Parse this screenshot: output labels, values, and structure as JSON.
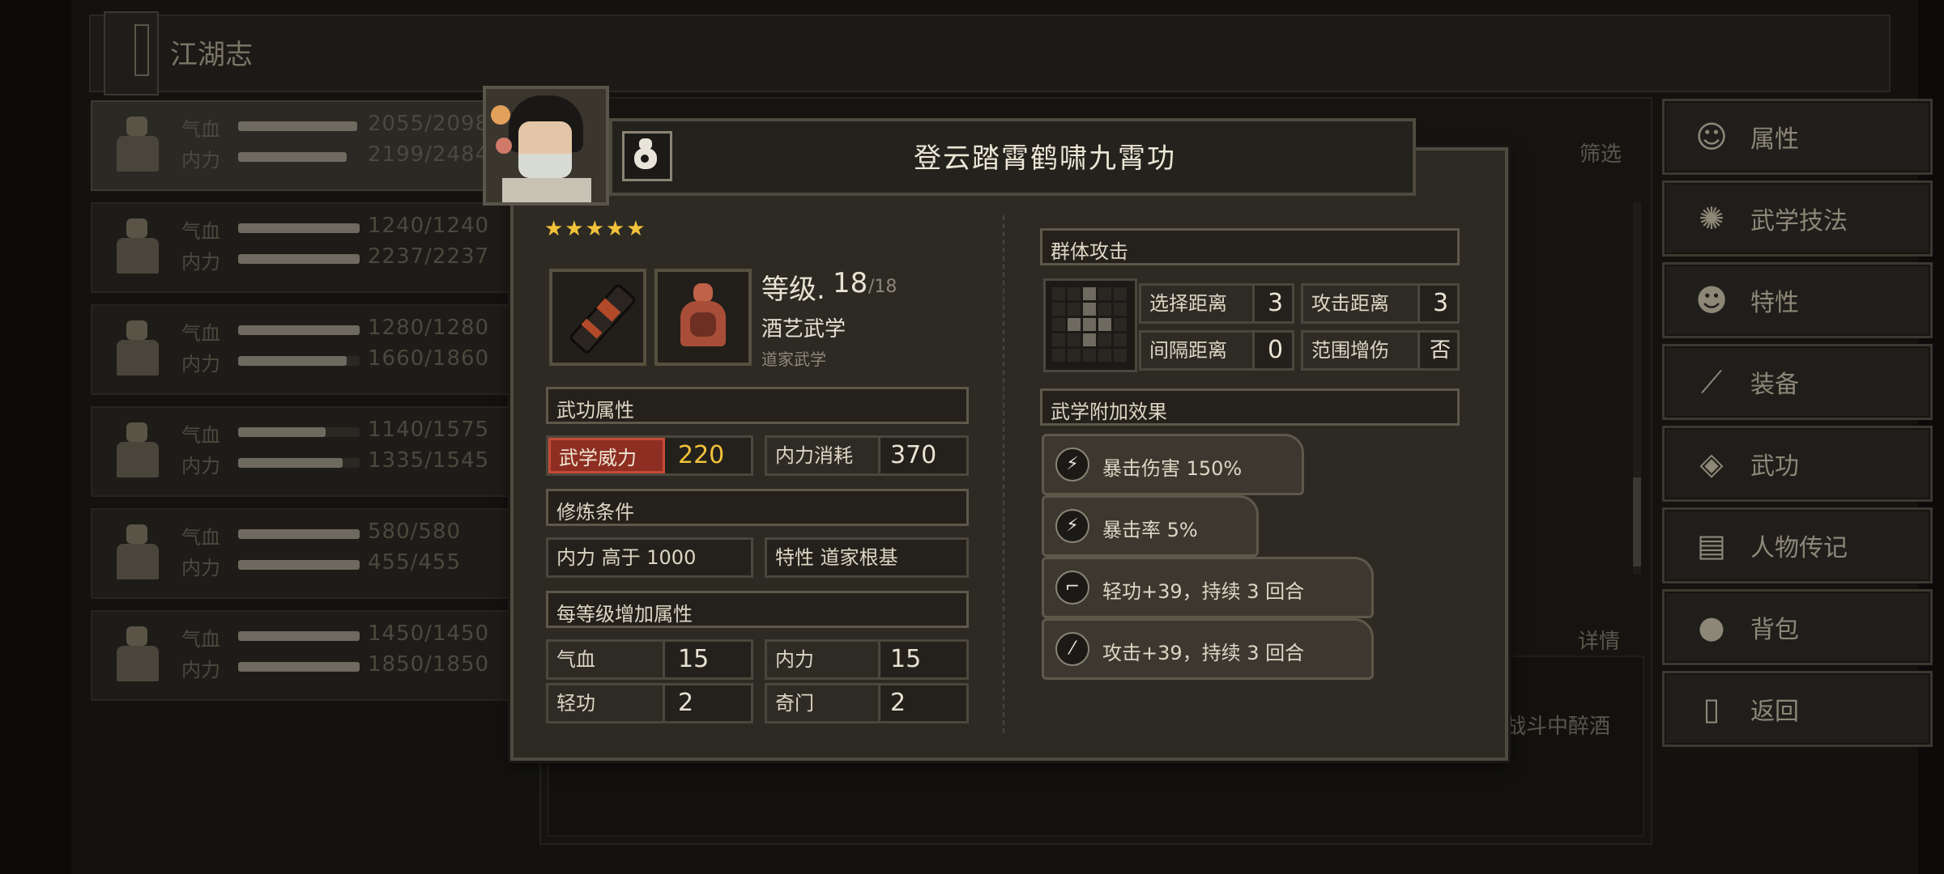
{
  "page": {
    "title": "江湖志",
    "filter_label": "筛选",
    "detail_label": "详情",
    "bg_text": "战斗中醉酒"
  },
  "characters": [
    {
      "hp_label": "气血",
      "mp_label": "内力",
      "hp": "2055/2098",
      "mp": "2199/2484",
      "hp_fill": 0.98,
      "mp_fill": 0.89
    },
    {
      "hp_label": "气血",
      "mp_label": "内力",
      "hp": "1240/1240",
      "mp": "2237/2237",
      "hp_fill": 1.0,
      "mp_fill": 1.0
    },
    {
      "hp_label": "气血",
      "mp_label": "内力",
      "hp": "1280/1280",
      "mp": "1660/1860",
      "hp_fill": 1.0,
      "mp_fill": 0.89
    },
    {
      "hp_label": "气血",
      "mp_label": "内力",
      "hp": "1140/1575",
      "mp": "1335/1545",
      "hp_fill": 0.72,
      "mp_fill": 0.86
    },
    {
      "hp_label": "气血",
      "mp_label": "内力",
      "hp": "580/580",
      "mp": "455/455",
      "hp_fill": 1.0,
      "mp_fill": 1.0
    },
    {
      "hp_label": "气血",
      "mp_label": "内力",
      "hp": "1450/1450",
      "mp": "1850/1850",
      "hp_fill": 1.0,
      "mp_fill": 1.0
    }
  ],
  "menu": [
    {
      "label": "属性",
      "icon": "person-icon"
    },
    {
      "label": "武学技法",
      "icon": "martial-skill-icon"
    },
    {
      "label": "特性",
      "icon": "trait-icon"
    },
    {
      "label": "装备",
      "icon": "sword-icon"
    },
    {
      "label": "武功",
      "icon": "book-icon"
    },
    {
      "label": "人物传记",
      "icon": "scroll-icon"
    },
    {
      "label": "背包",
      "icon": "bag-icon"
    },
    {
      "label": "返回",
      "icon": "door-icon"
    }
  ],
  "skill": {
    "name": "登云踏霄鹤啸九霄功",
    "stars": "★★★★★",
    "star_count": 5,
    "level_label": "等级.",
    "level": "18",
    "level_max": "/18",
    "type": "酒艺武学",
    "school": "道家武学",
    "attr_section": "武功属性",
    "power_label": "武学威力",
    "power_value": "220",
    "cost_label": "内力消耗",
    "cost_value": "370",
    "req_section": "修炼条件",
    "req1": "内力 高于 1000",
    "req2": "特性 道家根基",
    "per_level_section": "每等级增加属性",
    "per_level": [
      {
        "label": "气血",
        "value": "15"
      },
      {
        "label": "内力",
        "value": "15"
      },
      {
        "label": "轻功",
        "value": "2"
      },
      {
        "label": "奇门",
        "value": "2"
      }
    ],
    "attack_type": "群体攻击",
    "range": [
      {
        "label": "选择距离",
        "value": "3"
      },
      {
        "label": "攻击距离",
        "value": "3"
      },
      {
        "label": "间隔距离",
        "value": "0"
      },
      {
        "label": "范围增伤",
        "value": "否"
      }
    ],
    "effects_section": "武学附加效果",
    "effects": [
      {
        "text": "暴击伤害 150%",
        "icon": "lightning-icon"
      },
      {
        "text": "暴击率 5%",
        "icon": "lightning-circle-icon"
      },
      {
        "text": "轻功+39，持续 3 回合",
        "icon": "boot-icon"
      },
      {
        "text": "攻击+39，持续 3 回合",
        "icon": "sword-icon"
      }
    ]
  },
  "colors": {
    "accent_gold": "#f2c23a",
    "power_red": "#8e2e22",
    "panel": "#2d2a24"
  }
}
